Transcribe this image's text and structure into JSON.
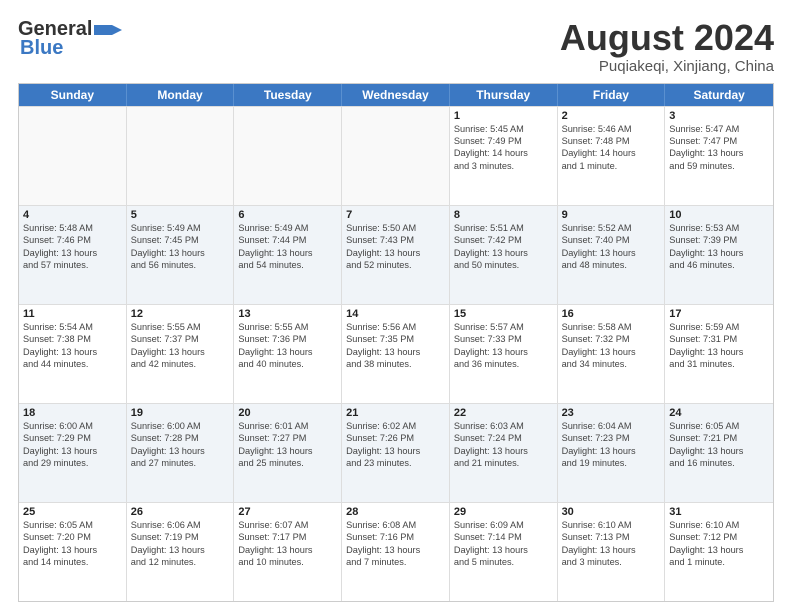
{
  "header": {
    "logo_line1": "General",
    "logo_line2": "Blue",
    "main_title": "August 2024",
    "subtitle": "Puqiakeqi, Xinjiang, China"
  },
  "weekdays": [
    "Sunday",
    "Monday",
    "Tuesday",
    "Wednesday",
    "Thursday",
    "Friday",
    "Saturday"
  ],
  "rows": [
    [
      {
        "day": "",
        "info": "",
        "empty": true
      },
      {
        "day": "",
        "info": "",
        "empty": true
      },
      {
        "day": "",
        "info": "",
        "empty": true
      },
      {
        "day": "",
        "info": "",
        "empty": true
      },
      {
        "day": "1",
        "info": "Sunrise: 5:45 AM\nSunset: 7:49 PM\nDaylight: 14 hours\nand 3 minutes."
      },
      {
        "day": "2",
        "info": "Sunrise: 5:46 AM\nSunset: 7:48 PM\nDaylight: 14 hours\nand 1 minute."
      },
      {
        "day": "3",
        "info": "Sunrise: 5:47 AM\nSunset: 7:47 PM\nDaylight: 13 hours\nand 59 minutes."
      }
    ],
    [
      {
        "day": "4",
        "info": "Sunrise: 5:48 AM\nSunset: 7:46 PM\nDaylight: 13 hours\nand 57 minutes."
      },
      {
        "day": "5",
        "info": "Sunrise: 5:49 AM\nSunset: 7:45 PM\nDaylight: 13 hours\nand 56 minutes."
      },
      {
        "day": "6",
        "info": "Sunrise: 5:49 AM\nSunset: 7:44 PM\nDaylight: 13 hours\nand 54 minutes."
      },
      {
        "day": "7",
        "info": "Sunrise: 5:50 AM\nSunset: 7:43 PM\nDaylight: 13 hours\nand 52 minutes."
      },
      {
        "day": "8",
        "info": "Sunrise: 5:51 AM\nSunset: 7:42 PM\nDaylight: 13 hours\nand 50 minutes."
      },
      {
        "day": "9",
        "info": "Sunrise: 5:52 AM\nSunset: 7:40 PM\nDaylight: 13 hours\nand 48 minutes."
      },
      {
        "day": "10",
        "info": "Sunrise: 5:53 AM\nSunset: 7:39 PM\nDaylight: 13 hours\nand 46 minutes."
      }
    ],
    [
      {
        "day": "11",
        "info": "Sunrise: 5:54 AM\nSunset: 7:38 PM\nDaylight: 13 hours\nand 44 minutes."
      },
      {
        "day": "12",
        "info": "Sunrise: 5:55 AM\nSunset: 7:37 PM\nDaylight: 13 hours\nand 42 minutes."
      },
      {
        "day": "13",
        "info": "Sunrise: 5:55 AM\nSunset: 7:36 PM\nDaylight: 13 hours\nand 40 minutes."
      },
      {
        "day": "14",
        "info": "Sunrise: 5:56 AM\nSunset: 7:35 PM\nDaylight: 13 hours\nand 38 minutes."
      },
      {
        "day": "15",
        "info": "Sunrise: 5:57 AM\nSunset: 7:33 PM\nDaylight: 13 hours\nand 36 minutes."
      },
      {
        "day": "16",
        "info": "Sunrise: 5:58 AM\nSunset: 7:32 PM\nDaylight: 13 hours\nand 34 minutes."
      },
      {
        "day": "17",
        "info": "Sunrise: 5:59 AM\nSunset: 7:31 PM\nDaylight: 13 hours\nand 31 minutes."
      }
    ],
    [
      {
        "day": "18",
        "info": "Sunrise: 6:00 AM\nSunset: 7:29 PM\nDaylight: 13 hours\nand 29 minutes."
      },
      {
        "day": "19",
        "info": "Sunrise: 6:00 AM\nSunset: 7:28 PM\nDaylight: 13 hours\nand 27 minutes."
      },
      {
        "day": "20",
        "info": "Sunrise: 6:01 AM\nSunset: 7:27 PM\nDaylight: 13 hours\nand 25 minutes."
      },
      {
        "day": "21",
        "info": "Sunrise: 6:02 AM\nSunset: 7:26 PM\nDaylight: 13 hours\nand 23 minutes."
      },
      {
        "day": "22",
        "info": "Sunrise: 6:03 AM\nSunset: 7:24 PM\nDaylight: 13 hours\nand 21 minutes."
      },
      {
        "day": "23",
        "info": "Sunrise: 6:04 AM\nSunset: 7:23 PM\nDaylight: 13 hours\nand 19 minutes."
      },
      {
        "day": "24",
        "info": "Sunrise: 6:05 AM\nSunset: 7:21 PM\nDaylight: 13 hours\nand 16 minutes."
      }
    ],
    [
      {
        "day": "25",
        "info": "Sunrise: 6:05 AM\nSunset: 7:20 PM\nDaylight: 13 hours\nand 14 minutes."
      },
      {
        "day": "26",
        "info": "Sunrise: 6:06 AM\nSunset: 7:19 PM\nDaylight: 13 hours\nand 12 minutes."
      },
      {
        "day": "27",
        "info": "Sunrise: 6:07 AM\nSunset: 7:17 PM\nDaylight: 13 hours\nand 10 minutes."
      },
      {
        "day": "28",
        "info": "Sunrise: 6:08 AM\nSunset: 7:16 PM\nDaylight: 13 hours\nand 7 minutes."
      },
      {
        "day": "29",
        "info": "Sunrise: 6:09 AM\nSunset: 7:14 PM\nDaylight: 13 hours\nand 5 minutes."
      },
      {
        "day": "30",
        "info": "Sunrise: 6:10 AM\nSunset: 7:13 PM\nDaylight: 13 hours\nand 3 minutes."
      },
      {
        "day": "31",
        "info": "Sunrise: 6:10 AM\nSunset: 7:12 PM\nDaylight: 13 hours\nand 1 minute."
      }
    ]
  ]
}
